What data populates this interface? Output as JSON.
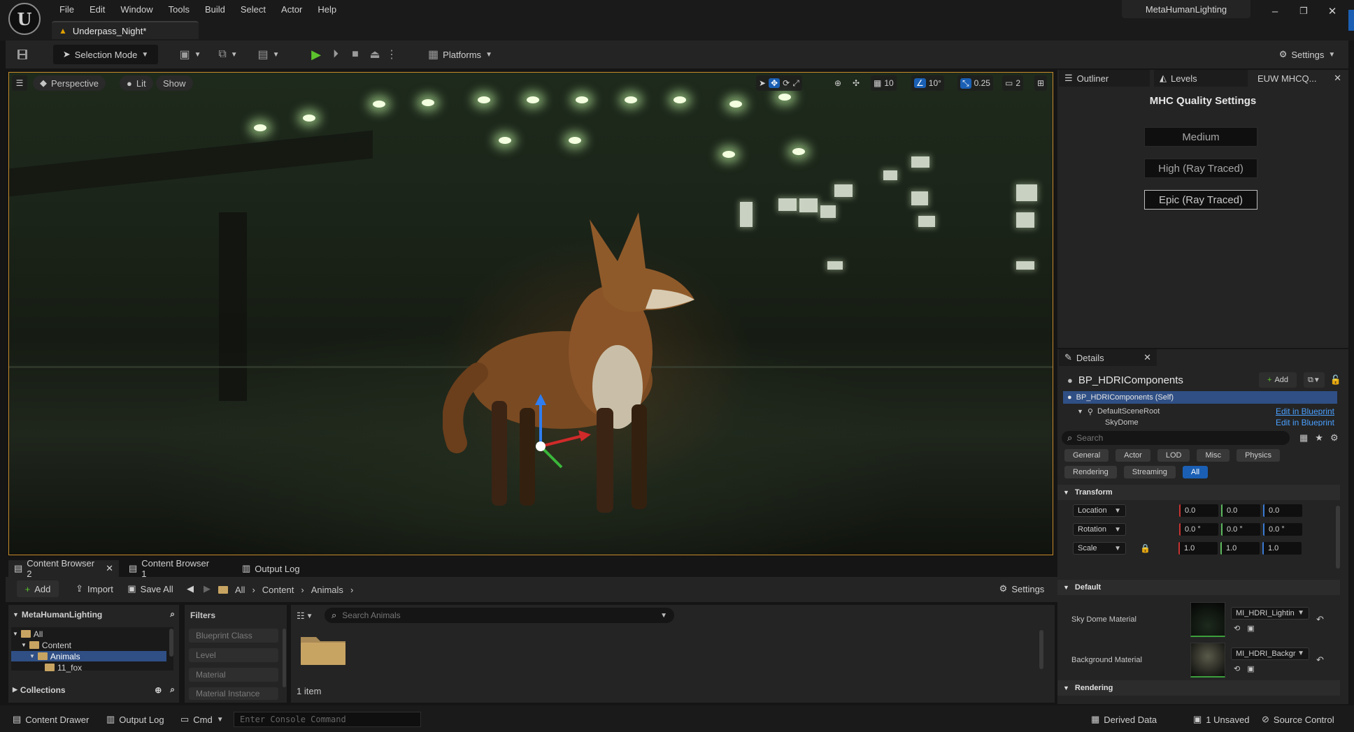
{
  "title_bar": {
    "logo": "U",
    "menus": [
      "File",
      "Edit",
      "Window",
      "Tools",
      "Build",
      "Select",
      "Actor",
      "Help"
    ],
    "document_tab": "Underpass_Night*",
    "project": "MetaHumanLighting",
    "window_controls": [
      "–",
      "❐",
      "✕"
    ]
  },
  "toolbar": {
    "selection_mode": "Selection Mode",
    "platforms": "Platforms",
    "settings": "Settings"
  },
  "viewport": {
    "perspective": "Perspective",
    "lit": "Lit",
    "show": "Show",
    "grid_snap": "10",
    "rotation_snap": "10°",
    "scale_snap": "0.25",
    "camera_speed": "2"
  },
  "right_dock": {
    "tabs": [
      "Outliner",
      "Levels",
      "EUW MHCQ..."
    ],
    "quality_title": "MHC Quality Settings",
    "quality_buttons": [
      "Medium",
      "High (Ray Traced)",
      "Epic (Ray Traced)"
    ]
  },
  "details": {
    "tab": "Details",
    "object_name": "BP_HDRIComponents",
    "add_label": "Add",
    "components": {
      "self": "BP_HDRIComponents (Self)",
      "root": "DefaultSceneRoot",
      "child": "SkyDome",
      "edit_link": "Edit in Blueprint"
    },
    "search_placeholder": "Search",
    "filters_row1": [
      "General",
      "Actor",
      "LOD",
      "Misc",
      "Physics"
    ],
    "filters_row2": [
      "Rendering",
      "Streaming",
      "All"
    ],
    "transform": {
      "header": "Transform",
      "location": {
        "label": "Location",
        "x": "0.0",
        "y": "0.0",
        "z": "0.0"
      },
      "rotation": {
        "label": "Rotation",
        "x": "0.0 °",
        "y": "0.0 °",
        "z": "0.0 °"
      },
      "scale": {
        "label": "Scale",
        "x": "1.0",
        "y": "1.0",
        "z": "1.0"
      }
    },
    "default": {
      "header": "Default",
      "sky_dome": {
        "label": "Sky Dome Material",
        "value": "MI_HDRI_Lightin"
      },
      "background": {
        "label": "Background Material",
        "value": "MI_HDRI_Backgr"
      }
    },
    "rendering_header": "Rendering"
  },
  "content_browser": {
    "tabs": [
      "Content Browser 2",
      "Content Browser 1",
      "Output Log"
    ],
    "add": "Add",
    "import": "Import",
    "save_all": "Save All",
    "breadcrumb": [
      "All",
      "Content",
      "Animals"
    ],
    "settings": "Settings",
    "tree_title": "MetaHumanLighting",
    "tree": [
      "All",
      "Content",
      "Animals",
      "11_fox"
    ],
    "collections": "Collections",
    "filters_title": "Filters",
    "filters": [
      "Blueprint Class",
      "Level",
      "Material",
      "Material Instance"
    ],
    "search_placeholder": "Search Animals",
    "item_count": "1 item"
  },
  "status_bar": {
    "content_drawer": "Content Drawer",
    "output_log": "Output Log",
    "cmd": "Cmd",
    "console_placeholder": "Enter Console Command",
    "derived_data": "Derived Data",
    "unsaved": "1 Unsaved",
    "source_control": "Source Control"
  },
  "colors": {
    "accent": "#1a5fb4",
    "play": "#5cc32d",
    "viewport_border": "#c78a2a",
    "link": "#4aa0ff"
  }
}
